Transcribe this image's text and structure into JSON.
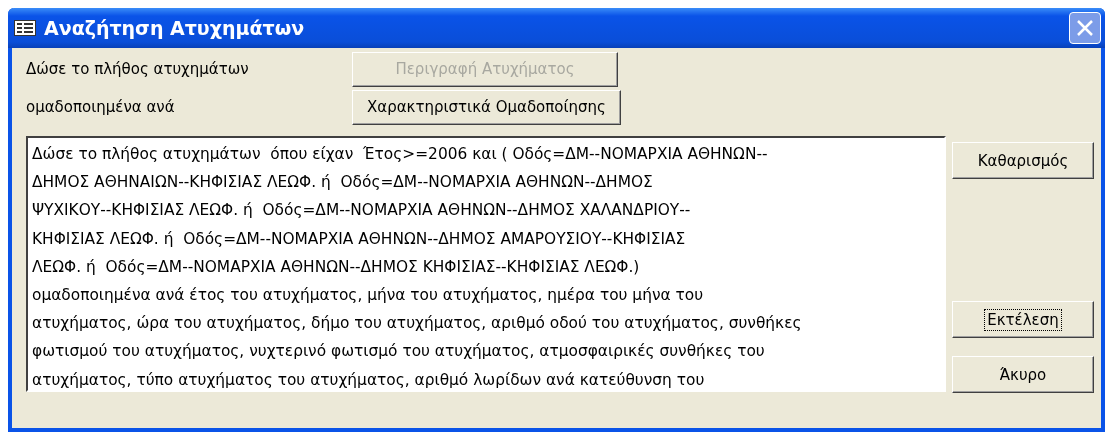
{
  "window": {
    "title": "Αναζήτηση Ατυχημάτων",
    "close_disabled": true
  },
  "rows": [
    {
      "label": "Δώσε το πλήθος ατυχημάτων",
      "button": {
        "label": "Περιγραφή Ατυχήματος",
        "disabled": true
      }
    },
    {
      "label": "ομαδοποιημένα ανά",
      "button": {
        "label": "Χαρακτηριστικά Ομαδοποίησης",
        "disabled": false
      }
    }
  ],
  "query_text": [
    "Δώσε το πλήθος ατυχημάτων  όπου είχαν  Έτος>=2006 και ( Οδός=ΔΜ--ΝΟΜΑΡΧΙΑ ΑΘΗΝΩΝ--",
    "ΔΗΜΟΣ ΑΘΗΝΑΙΩΝ--ΚΗΦΙΣΙΑΣ ΛΕΩΦ. ή  Οδός=ΔΜ--ΝΟΜΑΡΧΙΑ ΑΘΗΝΩΝ--ΔΗΜΟΣ",
    "ΨΥΧΙΚΟΥ--ΚΗΦΙΣΙΑΣ ΛΕΩΦ. ή  Οδός=ΔΜ--ΝΟΜΑΡΧΙΑ ΑΘΗΝΩΝ--ΔΗΜΟΣ ΧΑΛΑΝΔΡΙΟΥ--",
    "ΚΗΦΙΣΙΑΣ ΛΕΩΦ. ή  Οδός=ΔΜ--ΝΟΜΑΡΧΙΑ ΑΘΗΝΩΝ--ΔΗΜΟΣ ΑΜΑΡΟΥΣΙΟΥ--ΚΗΦΙΣΙΑΣ",
    "ΛΕΩΦ. ή  Οδός=ΔΜ--ΝΟΜΑΡΧΙΑ ΑΘΗΝΩΝ--ΔΗΜΟΣ ΚΗΦΙΣΙΑΣ--ΚΗΦΙΣΙΑΣ ΛΕΩΦ.)",
    "ομαδοποιημένα ανά έτος του ατυχήματος, μήνα του ατυχήματος, ημέρα του μήνα του",
    "ατυχήματος, ώρα του ατυχήματος, δήμο του ατυχήματος, αριθμό οδού του ατυχήματος, συνθήκες",
    "φωτισμού του ατυχήματος, νυχτερινό φωτισμό του ατυχήματος, ατμοσφαιρικές συνθήκες του",
    "ατυχήματος, τύπο ατυχήματος του ατυχήματος, αριθμό λωρίδων ανά κατεύθυνση του"
  ],
  "side_buttons": [
    {
      "label": "Καθαρισμός",
      "focused": false
    },
    {
      "label": "Εκτέλεση",
      "focused": true
    },
    {
      "label": "Άκυρο",
      "focused": false
    }
  ]
}
